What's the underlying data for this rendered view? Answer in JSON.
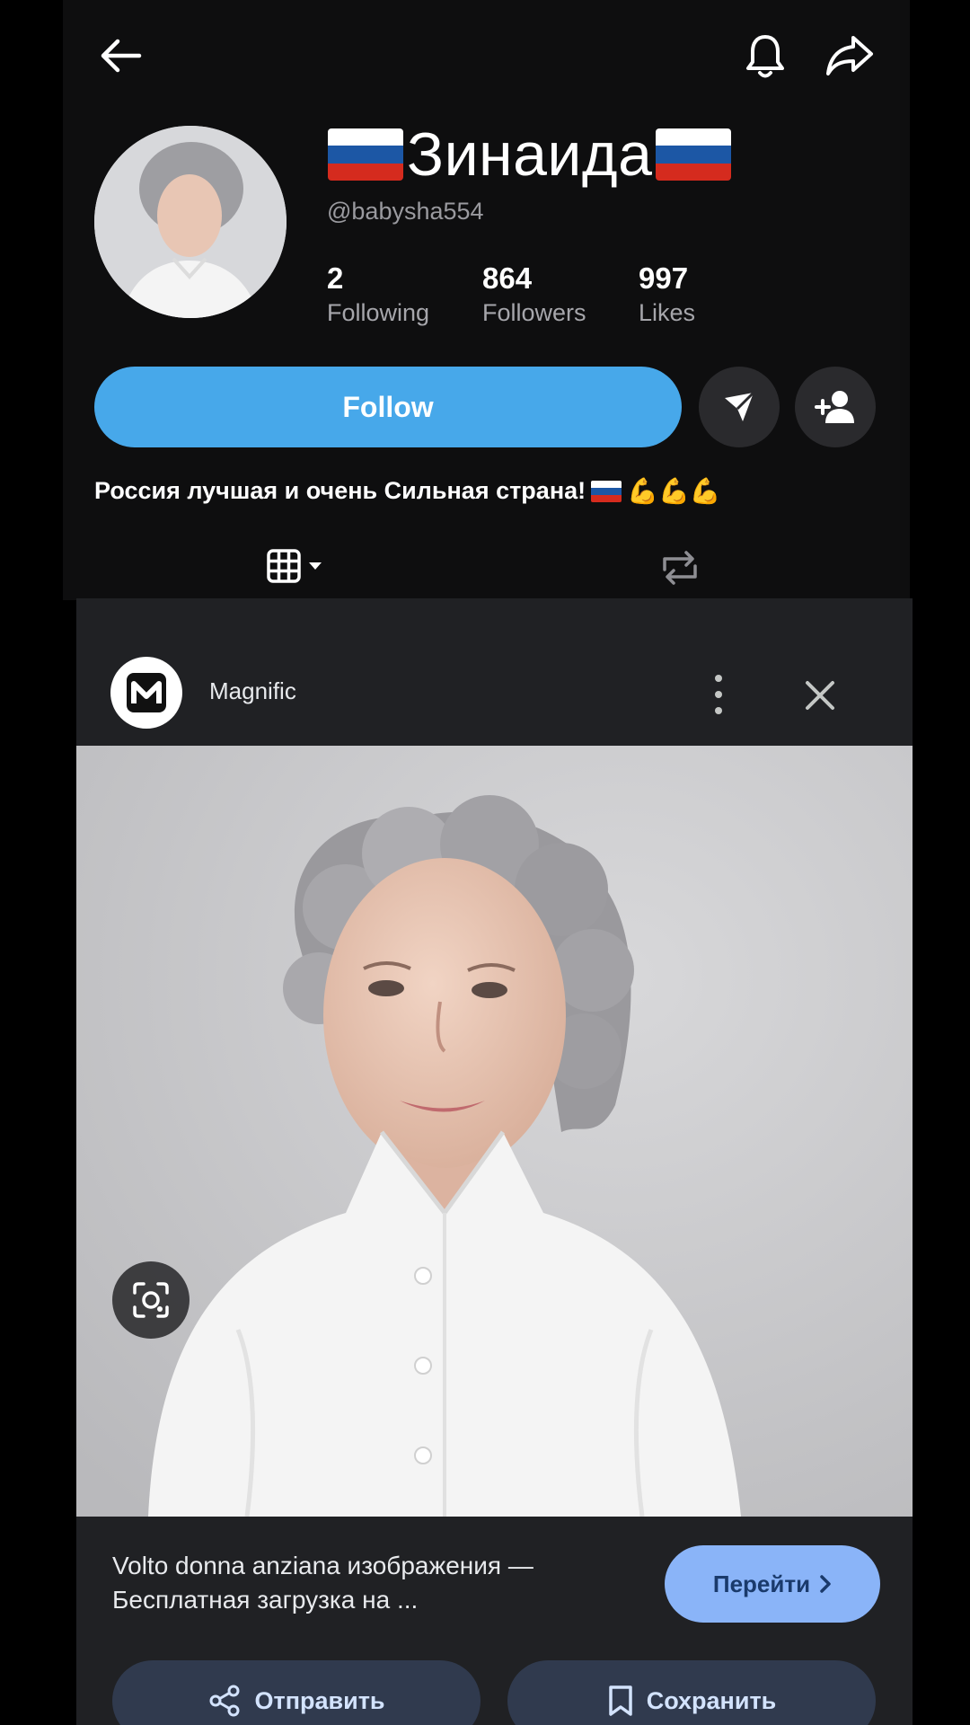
{
  "profile": {
    "display_name": "Зинаида",
    "handle": "@babysha554",
    "stats": [
      {
        "value": "2",
        "label": "Following"
      },
      {
        "value": "864",
        "label": "Followers"
      },
      {
        "value": "997",
        "label": "Likes"
      }
    ],
    "follow_label": "Follow",
    "bio_text": "Россия лучшая и очень Сильная страна!",
    "bio_emoji": "💪💪💪",
    "flag_colors": [
      "#ffffff",
      "#1c57a5",
      "#d52b1e"
    ]
  },
  "topbar": {
    "icons": [
      "back-arrow-icon",
      "bell-icon",
      "share-arrow-icon"
    ]
  },
  "tabs": {
    "icons": [
      "grid-icon",
      "repost-icon"
    ]
  },
  "lens_sheet": {
    "source_name": "Magnific",
    "result_title": "Volto donna anziana изображения — Бесплатная загрузка на ...",
    "visit_label": "Перейти",
    "send_label": "Отправить",
    "save_label": "Сохранить"
  },
  "colors": {
    "accent_follow": "#47a8ea",
    "visit_button": "#8ab4f8",
    "sheet_bg": "#202124"
  }
}
